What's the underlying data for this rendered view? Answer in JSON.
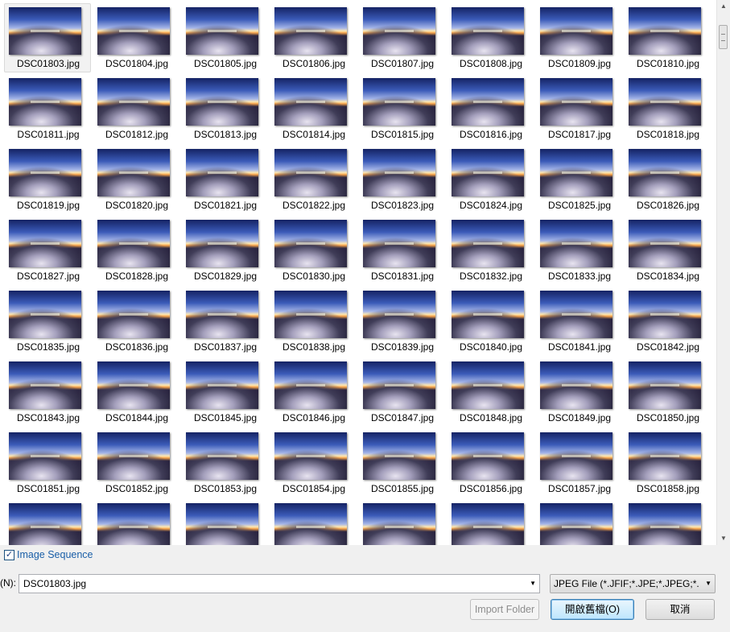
{
  "files": [
    "DSC01803.jpg",
    "DSC01804.jpg",
    "DSC01805.jpg",
    "DSC01806.jpg",
    "DSC01807.jpg",
    "DSC01808.jpg",
    "DSC01809.jpg",
    "DSC01810.jpg",
    "DSC01811.jpg",
    "DSC01812.jpg",
    "DSC01813.jpg",
    "DSC01814.jpg",
    "DSC01815.jpg",
    "DSC01816.jpg",
    "DSC01817.jpg",
    "DSC01818.jpg",
    "DSC01819.jpg",
    "DSC01820.jpg",
    "DSC01821.jpg",
    "DSC01822.jpg",
    "DSC01823.jpg",
    "DSC01824.jpg",
    "DSC01825.jpg",
    "DSC01826.jpg",
    "DSC01827.jpg",
    "DSC01828.jpg",
    "DSC01829.jpg",
    "DSC01830.jpg",
    "DSC01831.jpg",
    "DSC01832.jpg",
    "DSC01833.jpg",
    "DSC01834.jpg",
    "DSC01835.jpg",
    "DSC01836.jpg",
    "DSC01837.jpg",
    "DSC01838.jpg",
    "DSC01839.jpg",
    "DSC01840.jpg",
    "DSC01841.jpg",
    "DSC01842.jpg",
    "DSC01843.jpg",
    "DSC01844.jpg",
    "DSC01845.jpg",
    "DSC01846.jpg",
    "DSC01847.jpg",
    "DSC01848.jpg",
    "DSC01849.jpg",
    "DSC01850.jpg",
    "DSC01851.jpg",
    "DSC01852.jpg",
    "DSC01853.jpg",
    "DSC01854.jpg",
    "DSC01855.jpg",
    "DSC01856.jpg",
    "DSC01857.jpg",
    "DSC01858.jpg",
    "",
    "",
    "",
    "",
    "",
    "",
    "",
    ""
  ],
  "selected_file": "DSC01803.jpg",
  "image_sequence": {
    "label": "Image Sequence",
    "checked": true,
    "check_glyph": "✓"
  },
  "filename": {
    "label": "(N):",
    "value": "DSC01803.jpg",
    "dropdown_icon": "chevron-down-icon"
  },
  "file_type": {
    "value": "JPEG File  (*.JFIF;*.JPE;*.JPEG;*.JPG)"
  },
  "buttons": {
    "import_folder": "Import Folder",
    "open": "開啟舊檔(O)",
    "cancel": "取消"
  },
  "icons": {
    "scroll_up": "▲",
    "scroll_down": "▼",
    "dropdown": "▼"
  },
  "colors": {
    "link_blue": "#1a5fa8",
    "selection_bg": "#f2f2f2",
    "default_button_border": "#3c7fb1"
  }
}
